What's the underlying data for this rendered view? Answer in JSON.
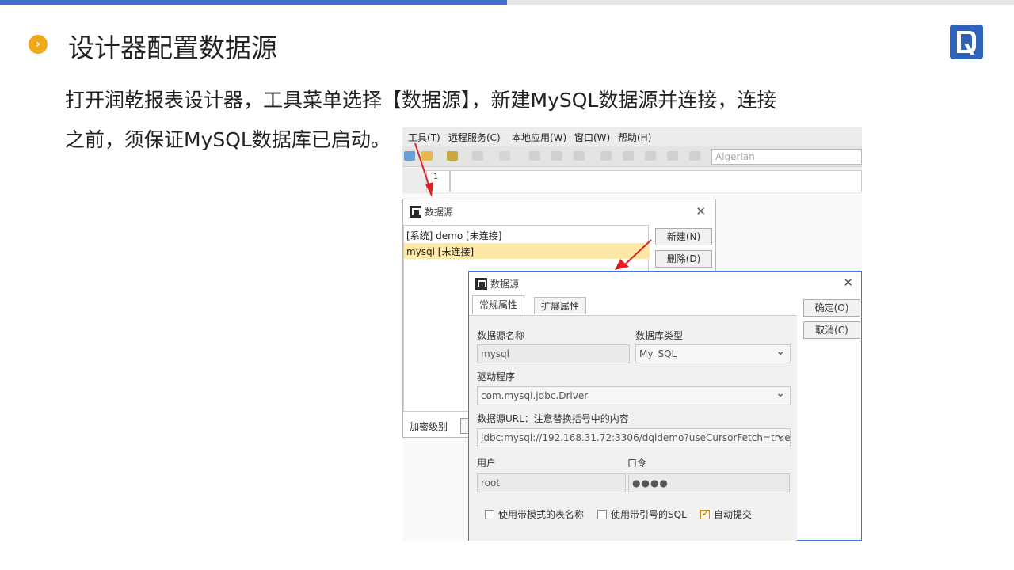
{
  "title": "设计器配置数据源",
  "description_line1": "打开润乾报表设计器，工具菜单选择【数据源】，新建MySQL数据源并连接，连接",
  "description_line2": "之前，须保证MySQL数据库已启动。",
  "app": {
    "menus": [
      "工具(T)",
      "远程服务(C)",
      "本地应用(W)",
      "窗口(W)",
      "帮助(H)"
    ],
    "font_box": "Algerian",
    "cell_row": "1"
  },
  "datasource_list_dialog": {
    "title": "数据源",
    "items": [
      {
        "label": "[系统] demo [未连接]",
        "selected": false
      },
      {
        "label": "mysql [未连接]",
        "selected": true
      }
    ],
    "new_button": "新建(N)",
    "delete_button": "删除(D)",
    "encrypt_label": "加密级别"
  },
  "datasource_dialog": {
    "title": "数据源",
    "tabs": [
      "常规属性",
      "扩展属性"
    ],
    "ok_button": "确定(O)",
    "cancel_button": "取消(C)",
    "name_label": "数据源名称",
    "name_value": "mysql",
    "dbtype_label": "数据库类型",
    "dbtype_value": "My_SQL",
    "driver_label": "驱动程序",
    "driver_value": "com.mysql.jdbc.Driver",
    "url_label": "数据源URL：注意替换括号中的内容",
    "url_value": "jdbc:mysql://192.168.31.72:3306/dqldemo?useCursorFetch=true",
    "user_label": "用户",
    "user_value": "root",
    "password_label": "口令",
    "password_value": "●●●●",
    "checkboxes": [
      {
        "label": "使用带模式的表名称",
        "checked": false
      },
      {
        "label": "使用带引号的SQL",
        "checked": false
      },
      {
        "label": "自动提交",
        "checked": true
      }
    ]
  },
  "colors": {
    "accent_blue": "#3f6fcb",
    "bullet_orange": "#f0a81c",
    "selection": "#fde8a6",
    "arrow_red": "#e02020"
  }
}
